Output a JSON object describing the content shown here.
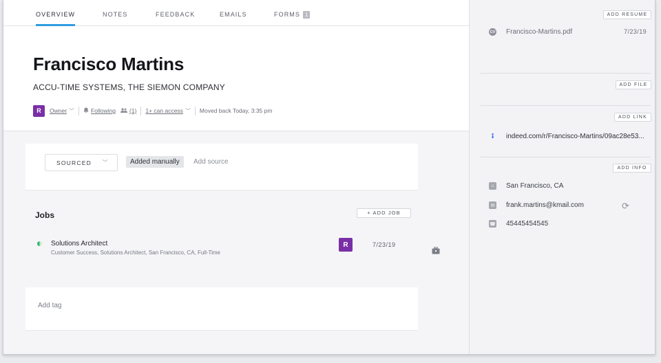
{
  "tabs": [
    {
      "label": "OVERVIEW"
    },
    {
      "label": "NOTES"
    },
    {
      "label": "FEEDBACK"
    },
    {
      "label": "EMAILS"
    },
    {
      "label": "FORMS",
      "badge": "1"
    }
  ],
  "candidate": {
    "name": "Francisco Martins",
    "company": "ACCU-TIME SYSTEMS, THE SIEMON COMPANY",
    "owner_initial": "R",
    "owner_label": "Owner",
    "following_label": "Following",
    "followers_count": "(1)",
    "access_label": "1+ can access",
    "moved_text": "Moved back Today, 3:35 pm"
  },
  "source": {
    "select_value": "SOURCED",
    "chip": "Added manually",
    "add_source": "Add source"
  },
  "jobs": {
    "title": "Jobs",
    "add_job_label": "+ ADD JOB",
    "items": [
      {
        "title": "Solutions Architect",
        "subtitle": "Customer Success, Solutions Architect, San Francisco, CA, Full-Time",
        "owner_initial": "R",
        "date": "7/23/19"
      }
    ]
  },
  "tags": {
    "add_tag": "Add tag"
  },
  "sidebar": {
    "add_resume": "ADD RESUME",
    "resume": {
      "icon_text": "CV",
      "file": "Francisco-Martins.pdf",
      "date": "7/23/19"
    },
    "add_file": "ADD FILE",
    "add_link": "ADD LINK",
    "link": "indeed.com/r/Francisco-Martins/09ac28e53...",
    "add_info": "ADD INFO",
    "location": "San Francisco, CA",
    "email": "frank.martins@kmail.com",
    "phone": "45445454545"
  },
  "colors": {
    "accent": "#2f9ce0",
    "avatar": "#7b2fa6",
    "status_green": "#35b36b",
    "indeed_blue": "#2164f3"
  }
}
